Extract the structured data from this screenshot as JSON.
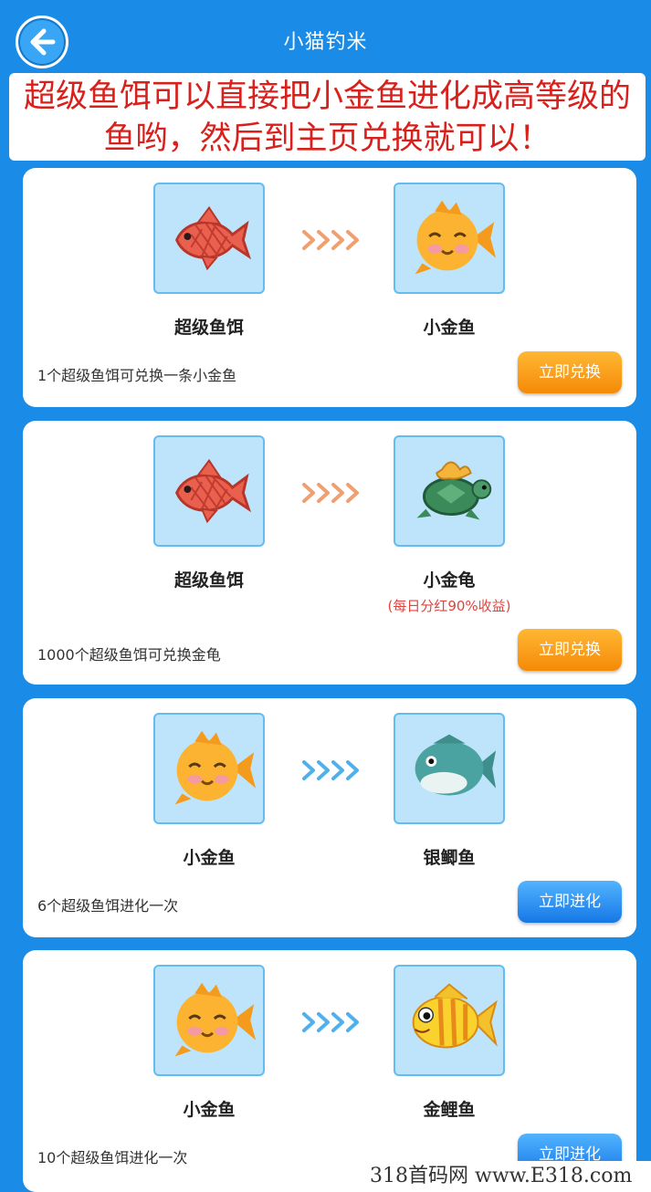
{
  "header": {
    "title": "小猫钓米"
  },
  "banner": {
    "line1": "超级鱼饵可以直接把小金鱼进化成高等级的",
    "line2": "鱼哟，然后到主页兑换就可以！"
  },
  "cards": [
    {
      "from": {
        "name": "超级鱼饵",
        "icon": "red-fish-icon"
      },
      "to": {
        "name": "小金鱼",
        "icon": "goldfish-icon"
      },
      "note": "",
      "desc": "1个超级鱼饵可兑换一条小金鱼",
      "button": "立即兑换",
      "arrow_color": "#f0a070"
    },
    {
      "from": {
        "name": "超级鱼饵",
        "icon": "red-fish-icon"
      },
      "to": {
        "name": "小金龟",
        "icon": "golden-turtle-icon"
      },
      "note": "(每日分红90%收益)",
      "desc": "1000个超级鱼饵可兑换金龟",
      "button": "立即兑换",
      "arrow_color": "#f0a070"
    },
    {
      "from": {
        "name": "小金鱼",
        "icon": "goldfish-icon"
      },
      "to": {
        "name": "银鲫鱼",
        "icon": "silver-carp-icon"
      },
      "note": "",
      "desc": "6个超级鱼饵进化一次",
      "button": "立即进化",
      "arrow_color": "#4fb0ec"
    },
    {
      "from": {
        "name": "小金鱼",
        "icon": "goldfish-icon"
      },
      "to": {
        "name": "金鲤鱼",
        "icon": "golden-carp-icon"
      },
      "note": "",
      "desc": "10个超级鱼饵进化一次",
      "button": "立即进化",
      "arrow_color": "#4fb0ec"
    }
  ],
  "watermark": "318首码网 www.E318.com",
  "colors": {
    "background": "#1a8be6",
    "banner_text": "#d8211c",
    "exchange_button": "#f58a07",
    "evolve_button": "#1677e6",
    "note_text": "#e0443c"
  }
}
